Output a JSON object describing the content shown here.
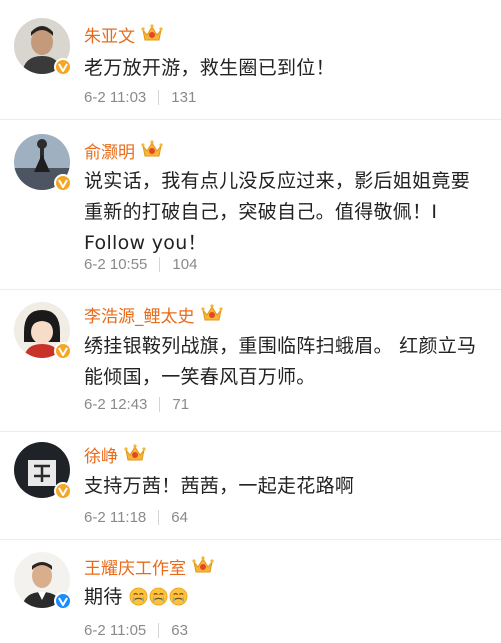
{
  "comments": [
    {
      "username": "朱亚文",
      "text": "老万放开游，救生圈已到位！",
      "date": "6-2 11:03",
      "likes": "131",
      "badge": "orange"
    },
    {
      "username": "俞灏明",
      "text": "说实话，我有点儿没反应过来，影后姐姐竟要重新的打破自己，突破自己。值得敬佩！I Follow you！",
      "date": "6-2 10:55",
      "likes": "104",
      "badge": "orange"
    },
    {
      "username": "李浩源_鲤太史",
      "text": "绣挂银鞍列战旗，重围临阵扫蛾眉。 红颜立马能倾国，一笑春风百万师。",
      "date": "6-2 12:43",
      "likes": "71",
      "badge": "orange"
    },
    {
      "username": "徐峥",
      "text": "支持万茜！茜茜，一起走花路啊",
      "date": "6-2 11:18",
      "likes": "64",
      "badge": "orange"
    },
    {
      "username": "王耀庆工作室",
      "text": "期待",
      "date": "6-2 11:05",
      "likes": "63",
      "badge": "blue"
    }
  ],
  "icons": {
    "crown": "vip-crown-icon",
    "verified_orange": "verified-orange-v-icon",
    "verified_blue": "verified-blue-v-icon",
    "emoji": "tearful-face-emoji-icon"
  },
  "colors": {
    "username": "#e86b1a",
    "text": "#222222",
    "meta": "#8a8a8a",
    "badge_orange": "#f5a623",
    "badge_blue": "#1a8cff"
  }
}
